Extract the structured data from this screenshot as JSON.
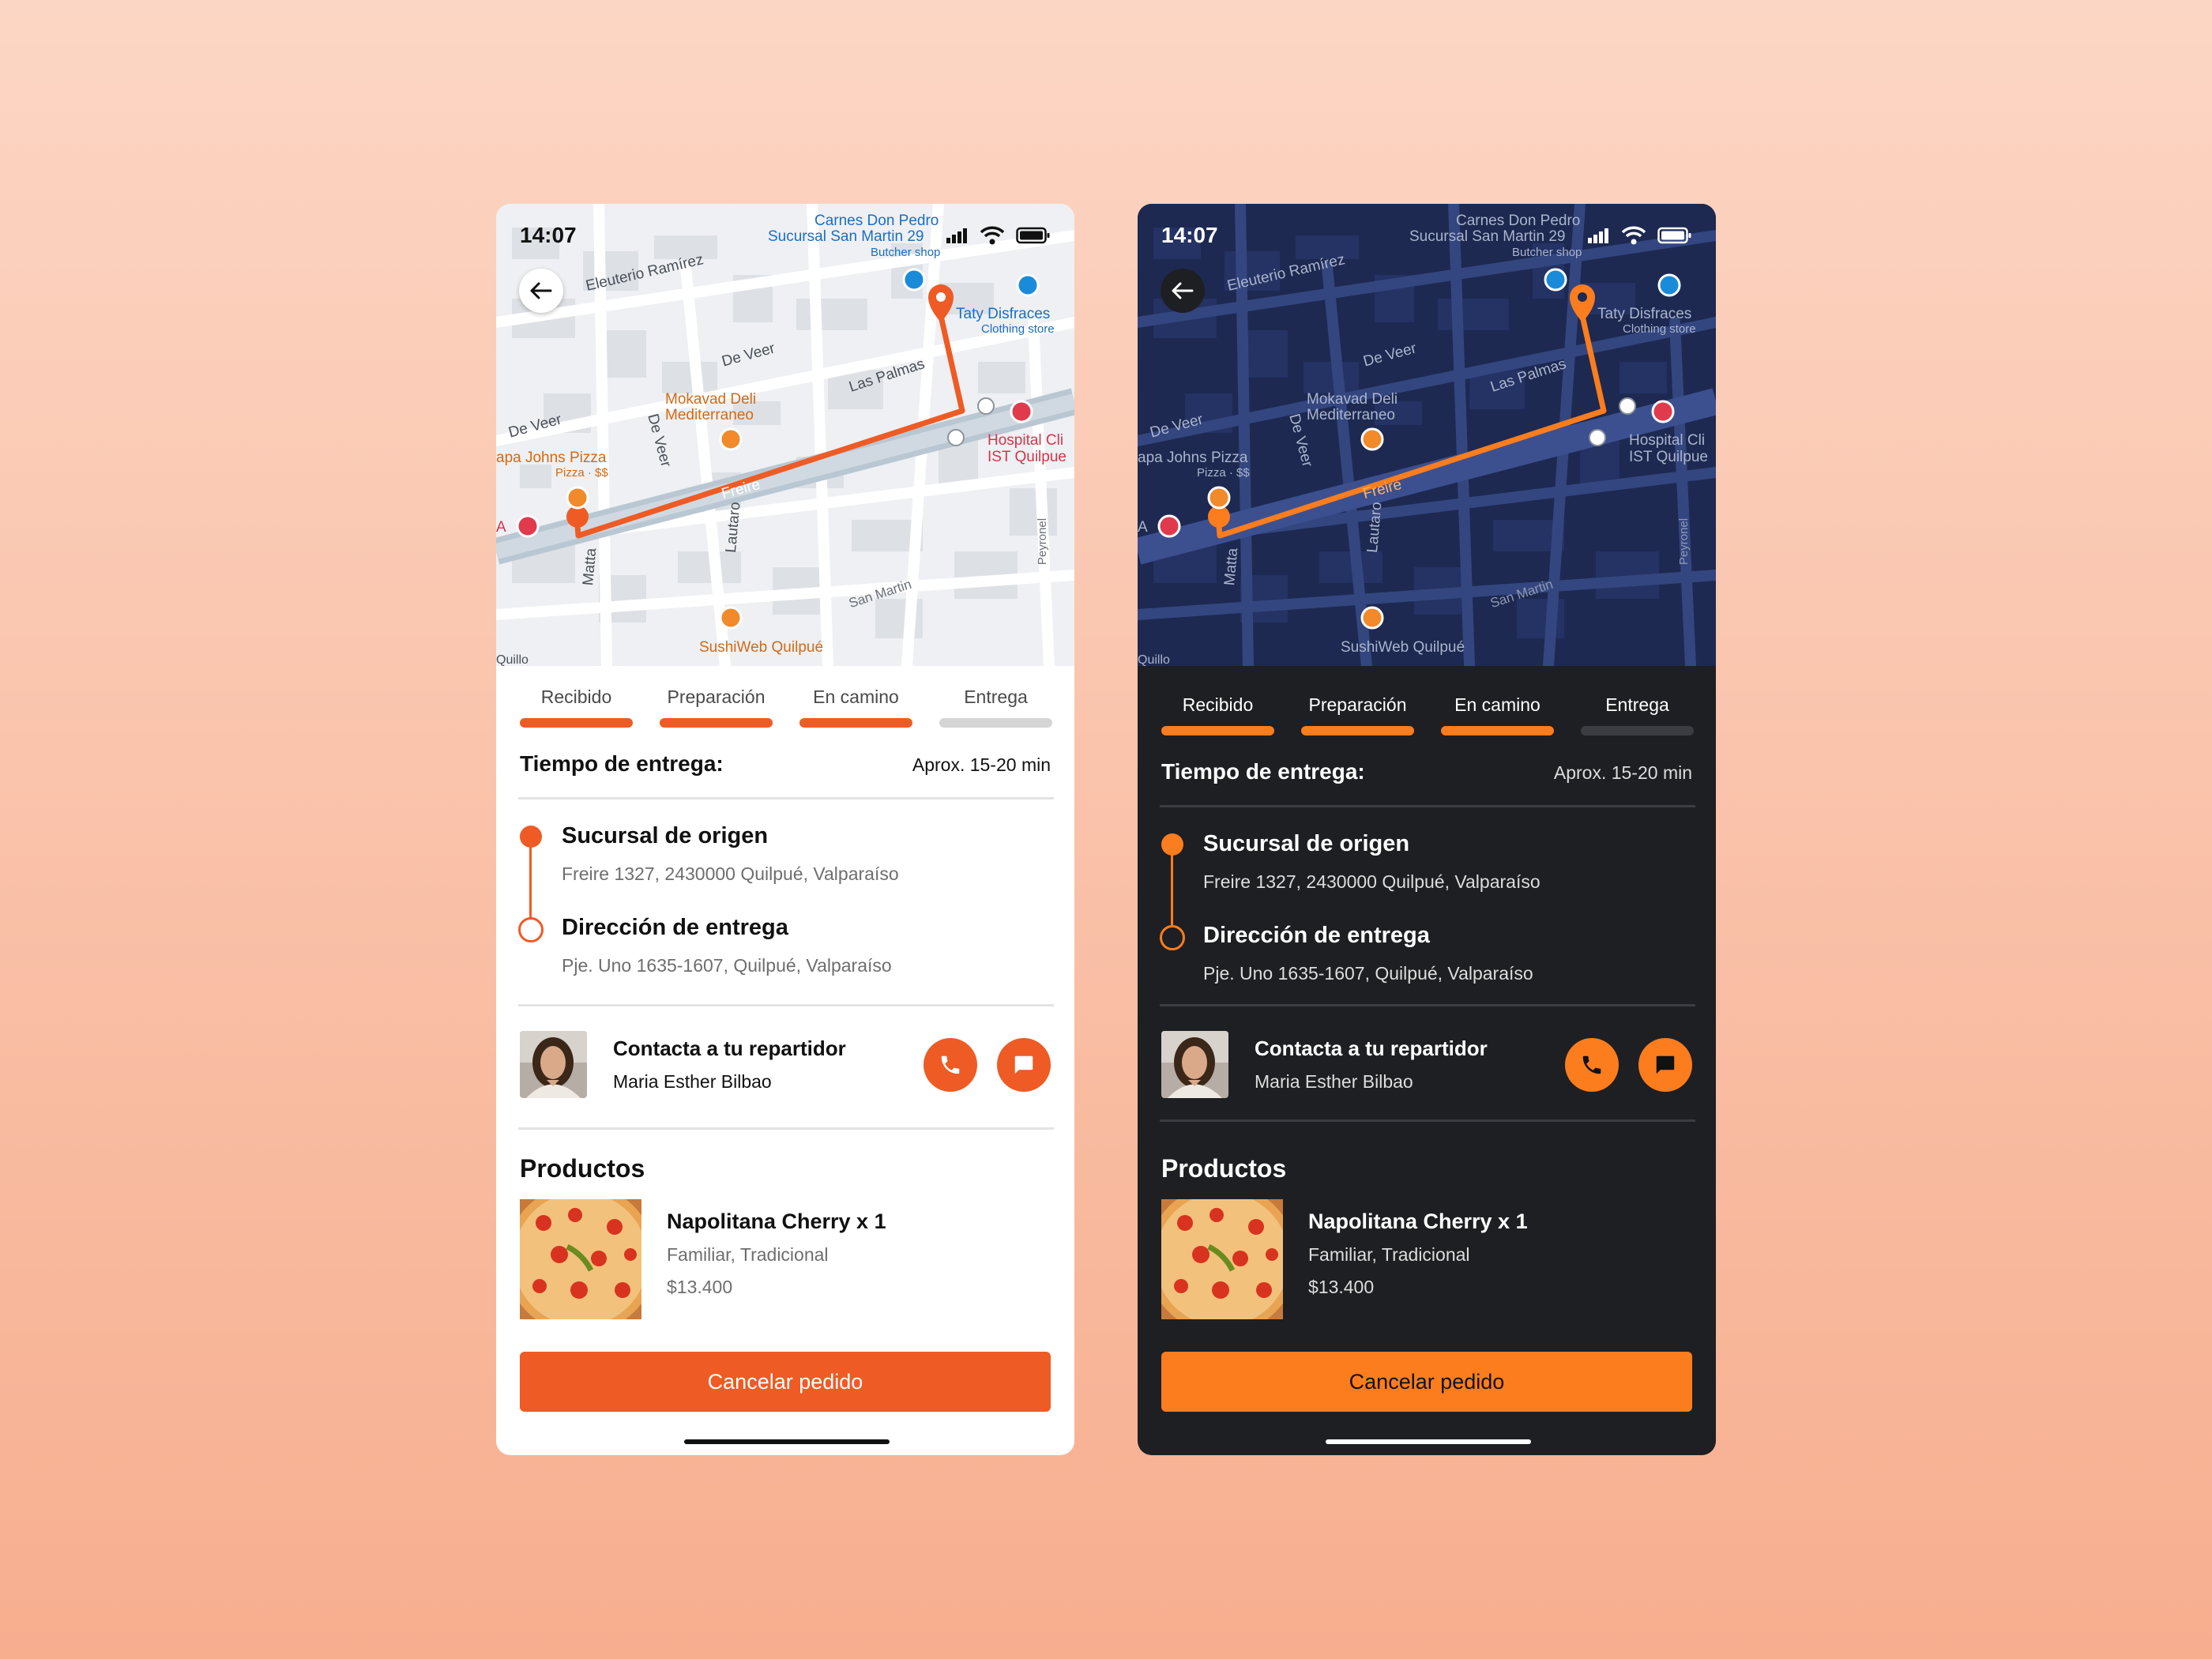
{
  "colors": {
    "accent_light": "#ee5b25",
    "accent_dark": "#fb7d1e",
    "inactive_light": "#d5d5d5",
    "inactive_dark": "#3b3d42",
    "bg_gradient_top": "#fcd6c4",
    "bg_gradient_bottom": "#f7ae8f"
  },
  "status_bar": {
    "time": "14:07"
  },
  "map": {
    "pois": {
      "carnes_line1": "Carnes Don Pedro",
      "carnes_line2": "Sucursal San Martin 29",
      "carnes_sub": "Butcher shop",
      "taty": "Taty Disfraces",
      "taty_sub": "Clothing store",
      "mokavad_line1": "Mokavad Deli",
      "mokavad_line2": "Mediterraneo",
      "papa_johns": "apa Johns Pizza",
      "papa_johns_sub": "Pizza · $$",
      "hospital_line1": "Hospital Cli",
      "hospital_line2": "IST Quilpue",
      "sushi": "SushiWeb Quilpué",
      "edge_a": "A"
    },
    "streets": {
      "eleuterio": "Eleuterio Ramírez",
      "de_veer_1": "De Veer",
      "de_veer_2": "De Veer",
      "de_veer_3": "De Veer",
      "las_palmas": "Las Palmas",
      "freire": "Freire",
      "lautaro": "Lautaro",
      "matta": "Matta",
      "san_martin": "San Martin",
      "peyronel": "Peyronel",
      "quillota": "Quillo"
    }
  },
  "progress": {
    "steps": [
      {
        "label": "Recibido",
        "done": true
      },
      {
        "label": "Preparación",
        "done": true
      },
      {
        "label": "En camino",
        "done": true
      },
      {
        "label": "Entrega",
        "done": false
      }
    ]
  },
  "delivery": {
    "title": "Tiempo de entrega:",
    "estimate": "Aprox. 15-20 min"
  },
  "origin": {
    "title": "Sucursal de origen",
    "address": "Freire 1327, 2430000 Quilpué, Valparaíso"
  },
  "destination": {
    "title": "Dirección de entrega",
    "address": "Pje. Uno 1635-1607, Quilpué, Valparaíso"
  },
  "courier": {
    "title": "Contacta a tu repartidor",
    "name": "Maria Esther Bilbao"
  },
  "products": {
    "title": "Productos",
    "items": [
      {
        "name": "Napolitana Cherry x 1",
        "details": "Familiar, Tradicional",
        "price": "$13.400"
      }
    ]
  },
  "actions": {
    "cancel": "Cancelar pedido"
  }
}
